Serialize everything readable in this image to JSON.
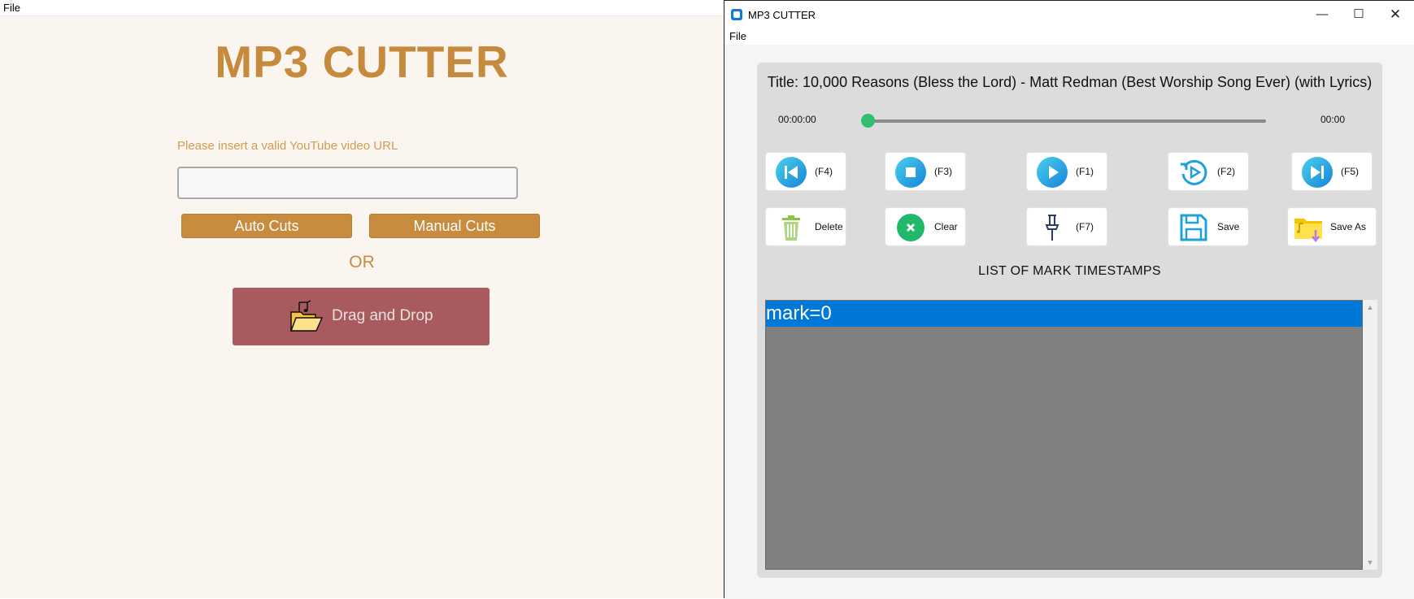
{
  "left_window": {
    "menu": {
      "file": "File"
    },
    "title": "MP3 CUTTER",
    "url_label": "Please insert a valid YouTube video URL",
    "url_value": "",
    "auto_cuts": "Auto Cuts",
    "manual_cuts": "Manual Cuts",
    "or_text": "OR",
    "drag_drop": "Drag and Drop"
  },
  "right_window": {
    "titlebar": {
      "title": "MP3 CUTTER",
      "minimize": "—",
      "maximize": "☐",
      "close": "✕"
    },
    "menu": {
      "file": "File"
    },
    "player": {
      "song_title": "Title: 10,000 Reasons (Bless the Lord) - Matt Redman (Best Worship Song Ever) (with Lyrics)",
      "time_current": "00:00:00",
      "time_total": "00:00",
      "seek_progress": 0
    },
    "controls": {
      "previous": {
        "label": "(F4)",
        "icon": "skip-previous-icon"
      },
      "stop": {
        "label": "(F3)",
        "icon": "stop-icon"
      },
      "play": {
        "label": "(F1)",
        "icon": "play-icon"
      },
      "replay": {
        "label": "(F2)",
        "icon": "replay-icon"
      },
      "next": {
        "label": "(F5)",
        "icon": "skip-next-icon"
      },
      "delete": {
        "label": "Delete",
        "icon": "trash-icon"
      },
      "clear": {
        "label": "Clear",
        "icon": "clear-icon"
      },
      "mark": {
        "label": "(F7)",
        "icon": "pin-icon"
      },
      "save": {
        "label": "Save",
        "icon": "floppy-icon"
      },
      "save_as": {
        "label": "Save As",
        "icon": "folder-music-icon"
      }
    },
    "list_heading": "LIST OF MARK TIMESTAMPS",
    "marks": [
      "mark=0"
    ]
  },
  "colors": {
    "accent_tan": "#c98b3d",
    "drag_button": "#a85a5f",
    "selection_blue": "#0078d7",
    "seek_knob": "#2fbf71"
  }
}
